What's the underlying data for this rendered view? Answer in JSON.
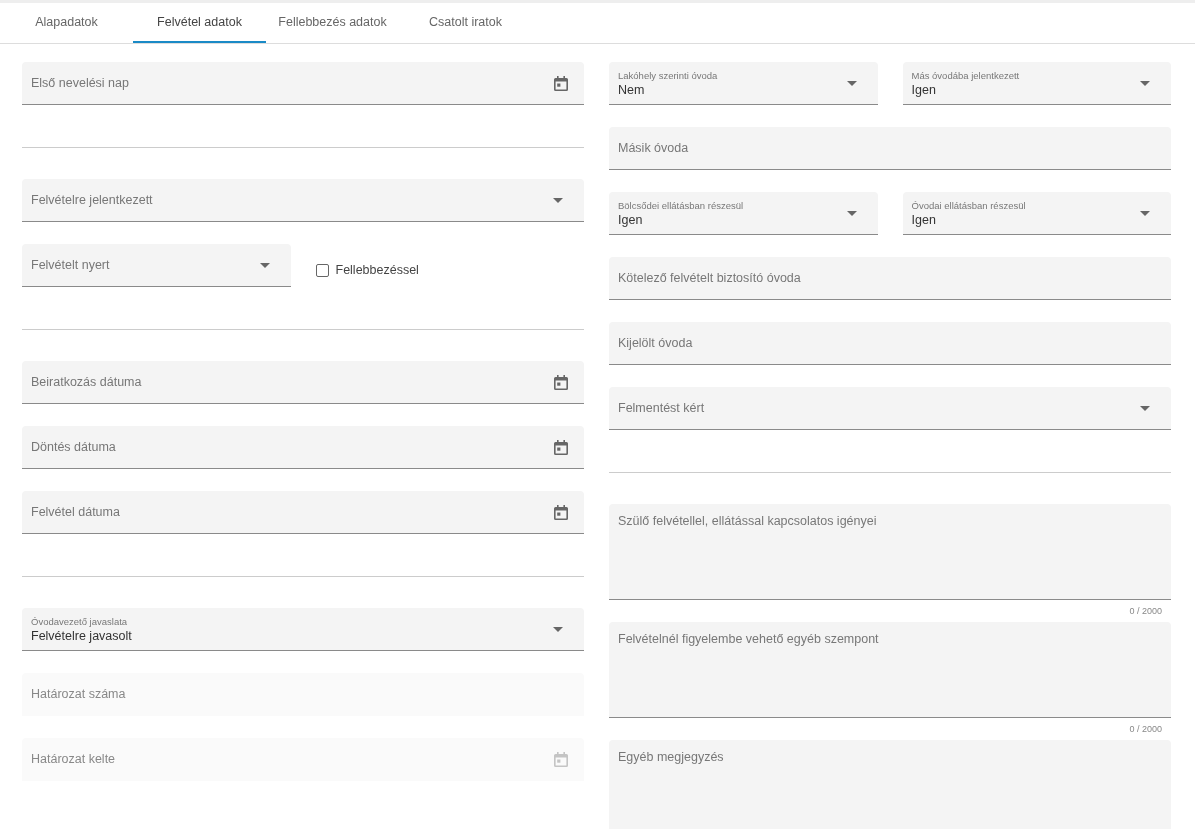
{
  "tabs": [
    {
      "label": "Alapadatok",
      "selected": false
    },
    {
      "label": "Felvétel adatok",
      "selected": true
    },
    {
      "label": "Fellebbezés adatok",
      "selected": false
    },
    {
      "label": "Csatolt iratok",
      "selected": false
    }
  ],
  "left": [
    {
      "kind": "date",
      "label": "Első nevelési nap",
      "disabled": false
    },
    {
      "kind": "blank"
    },
    {
      "kind": "select",
      "label": "Felvételre jelentkezett",
      "disabled": false
    },
    {
      "kind": "row",
      "items": [
        {
          "kind": "select",
          "label": "Felvételt nyert",
          "disabled": false
        },
        {
          "kind": "checkbox",
          "label": "Fellebbezéssel",
          "checked": false
        }
      ]
    },
    {
      "kind": "blank"
    },
    {
      "kind": "date",
      "label": "Beiratkozás dátuma",
      "disabled": false
    },
    {
      "kind": "date",
      "label": "Döntés dátuma",
      "disabled": false
    },
    {
      "kind": "date",
      "label": "Felvétel dátuma",
      "disabled": false
    },
    {
      "kind": "blank"
    },
    {
      "kind": "select",
      "label": "Óvodavezető javaslata",
      "value": "Felvételre javasolt",
      "disabled": false
    },
    {
      "kind": "text",
      "label": "Határozat száma",
      "disabled": true
    },
    {
      "kind": "date",
      "label": "Határozat kelte",
      "disabled": true
    }
  ],
  "right": [
    {
      "kind": "row",
      "items": [
        {
          "kind": "select",
          "label": "Lakóhely szerinti óvoda",
          "value": "Nem",
          "disabled": false
        },
        {
          "kind": "select",
          "label": "Más óvodába jelentkezett",
          "value": "Igen",
          "disabled": false
        }
      ]
    },
    {
      "kind": "text",
      "label": "Másik óvoda",
      "disabled": false
    },
    {
      "kind": "row",
      "items": [
        {
          "kind": "select",
          "label": "Bölcsődei ellátásban részesül",
          "value": "Igen",
          "disabled": false
        },
        {
          "kind": "select",
          "label": "Óvodai ellátásban részesül",
          "value": "Igen",
          "disabled": false
        }
      ]
    },
    {
      "kind": "text",
      "label": "Kötelező felvételt biztosító óvoda",
      "disabled": false
    },
    {
      "kind": "text",
      "label": "Kijelölt óvoda",
      "disabled": false
    },
    {
      "kind": "select",
      "label": "Felmentést kért",
      "disabled": false
    },
    {
      "kind": "blank"
    },
    {
      "kind": "textarea",
      "label": "Szülő felvétellel, ellátással kapcsolatos igényei",
      "counter": "0 / 2000",
      "disabled": false
    },
    {
      "kind": "textarea",
      "label": "Felvételnél figyelembe vehető egyéb szempont",
      "counter": "0 / 2000",
      "disabled": false
    },
    {
      "kind": "textarea",
      "label": "Egyéb megjegyzés",
      "disabled": false
    }
  ]
}
